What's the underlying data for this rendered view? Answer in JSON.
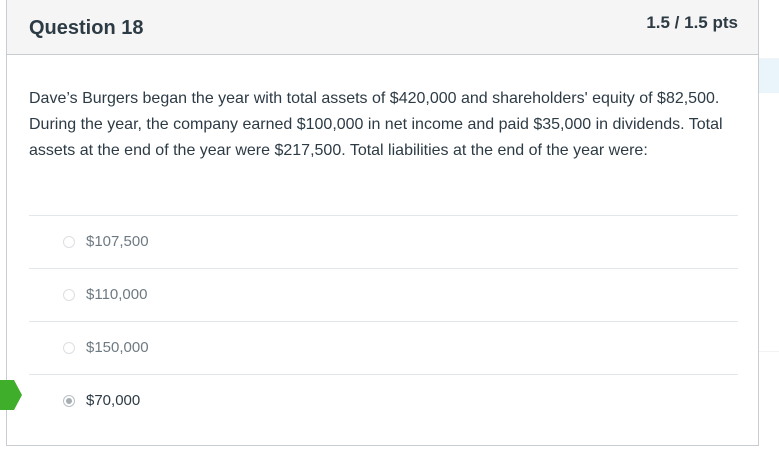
{
  "question": {
    "title": "Question 18",
    "points": "1.5 / 1.5 pts",
    "text": "Dave’s Burgers began the year with total assets of $420,000 and shareholders' equity of $82,500. During the year, the company earned $100,000 in net income and paid $35,000 in dividends. Total assets at the end of the year were $217,500. Total liabilities at the end of the year were:"
  },
  "answers": [
    {
      "label": "$107,500",
      "selected": false
    },
    {
      "label": "$110,000",
      "selected": false
    },
    {
      "label": "$150,000",
      "selected": false
    },
    {
      "label": "$70,000",
      "selected": true
    }
  ],
  "colors": {
    "correct_flag": "#3fae2a",
    "header_bg": "#f5f5f5",
    "text": "#2d3b45"
  },
  "icons": {
    "correct_flag": "correct-answer-arrow-icon",
    "side_widget": "tag-icon"
  }
}
